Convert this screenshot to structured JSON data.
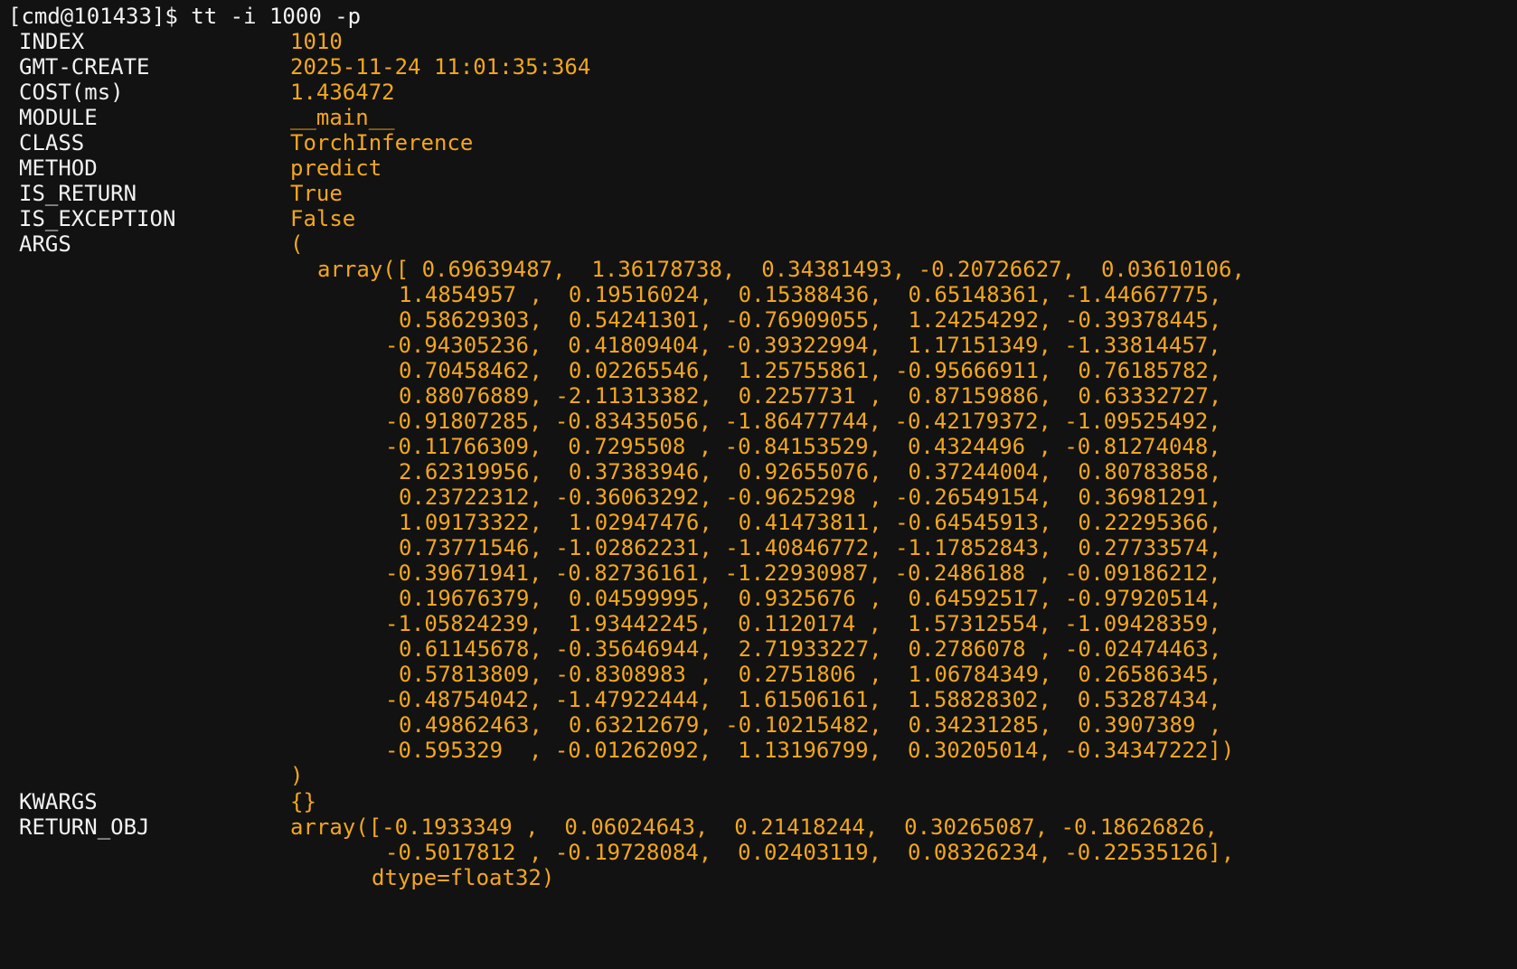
{
  "prompt": "[cmd@101433]$ tt -i 1000 -p",
  "fields": {
    "index": {
      "key": "INDEX",
      "value": "1010"
    },
    "gmt_create": {
      "key": "GMT-CREATE",
      "value": "2025-11-24 11:01:35:364"
    },
    "cost": {
      "key": "COST(ms)",
      "value": "1.436472"
    },
    "module": {
      "key": "MODULE",
      "value": "__main__"
    },
    "class": {
      "key": "CLASS",
      "value": "TorchInference"
    },
    "method": {
      "key": "METHOD",
      "value": "predict"
    },
    "is_return": {
      "key": "IS_RETURN",
      "value": "True"
    },
    "is_exception": {
      "key": "IS_EXCEPTION",
      "value": "False"
    },
    "args": {
      "key": "ARGS",
      "open": "(",
      "close": ")"
    },
    "kwargs": {
      "key": "KWARGS",
      "value": "{}"
    },
    "return_obj": {
      "key": "RETURN_OBJ"
    }
  },
  "args_array_lines": [
    "array([ 0.69639487,  1.36178738,  0.34381493, -0.20726627,  0.03610106,",
    "1.4854957 ,  0.19516024,  0.15388436,  0.65148361, -1.44667775,",
    "0.58629303,  0.54241301, -0.76909055,  1.24254292, -0.39378445,",
    "-0.94305236,  0.41809404, -0.39322994,  1.17151349, -1.33814457,",
    "0.70458462,  0.02265546,  1.25755861, -0.95666911,  0.76185782,",
    "0.88076889, -2.11313382,  0.2257731 ,  0.87159886,  0.63332727,",
    "-0.91807285, -0.83435056, -1.86477744, -0.42179372, -1.09525492,",
    "-0.11766309,  0.7295508 , -0.84153529,  0.4324496 , -0.81274048,",
    "2.62319956,  0.37383946,  0.92655076,  0.37244004,  0.80783858,",
    "0.23722312, -0.36063292, -0.9625298 , -0.26549154,  0.36981291,",
    "1.09173322,  1.02947476,  0.41473811, -0.64545913,  0.22295366,",
    "0.73771546, -1.02862231, -1.40846772, -1.17852843,  0.27733574,",
    "-0.39671941, -0.82736161, -1.22930987, -0.2486188 , -0.09186212,",
    "0.19676379,  0.04599995,  0.9325676 ,  0.64592517, -0.97920514,",
    "-1.05824239,  1.93442245,  0.1120174 ,  1.57312554, -1.09428359,",
    "0.61145678, -0.35646944,  2.71933227,  0.2786078 , -0.02474463,",
    "0.57813809, -0.8308983 ,  0.2751806 ,  1.06784349,  0.26586345,",
    "-0.48754042, -1.47922444,  1.61506161,  1.58828302,  0.53287434,",
    "0.49862463,  0.63212679, -0.10215482,  0.34231285,  0.3907389 ,",
    "-0.595329  , -0.01262092,  1.13196799,  0.30205014, -0.34347222])"
  ],
  "return_lines": [
    "array([-0.1933349 ,  0.06024643,  0.21418244,  0.30265087, -0.18626826,",
    "-0.5017812 , -0.19728084,  0.02403119,  0.08326234, -0.22535126],",
    "dtype=float32)"
  ]
}
